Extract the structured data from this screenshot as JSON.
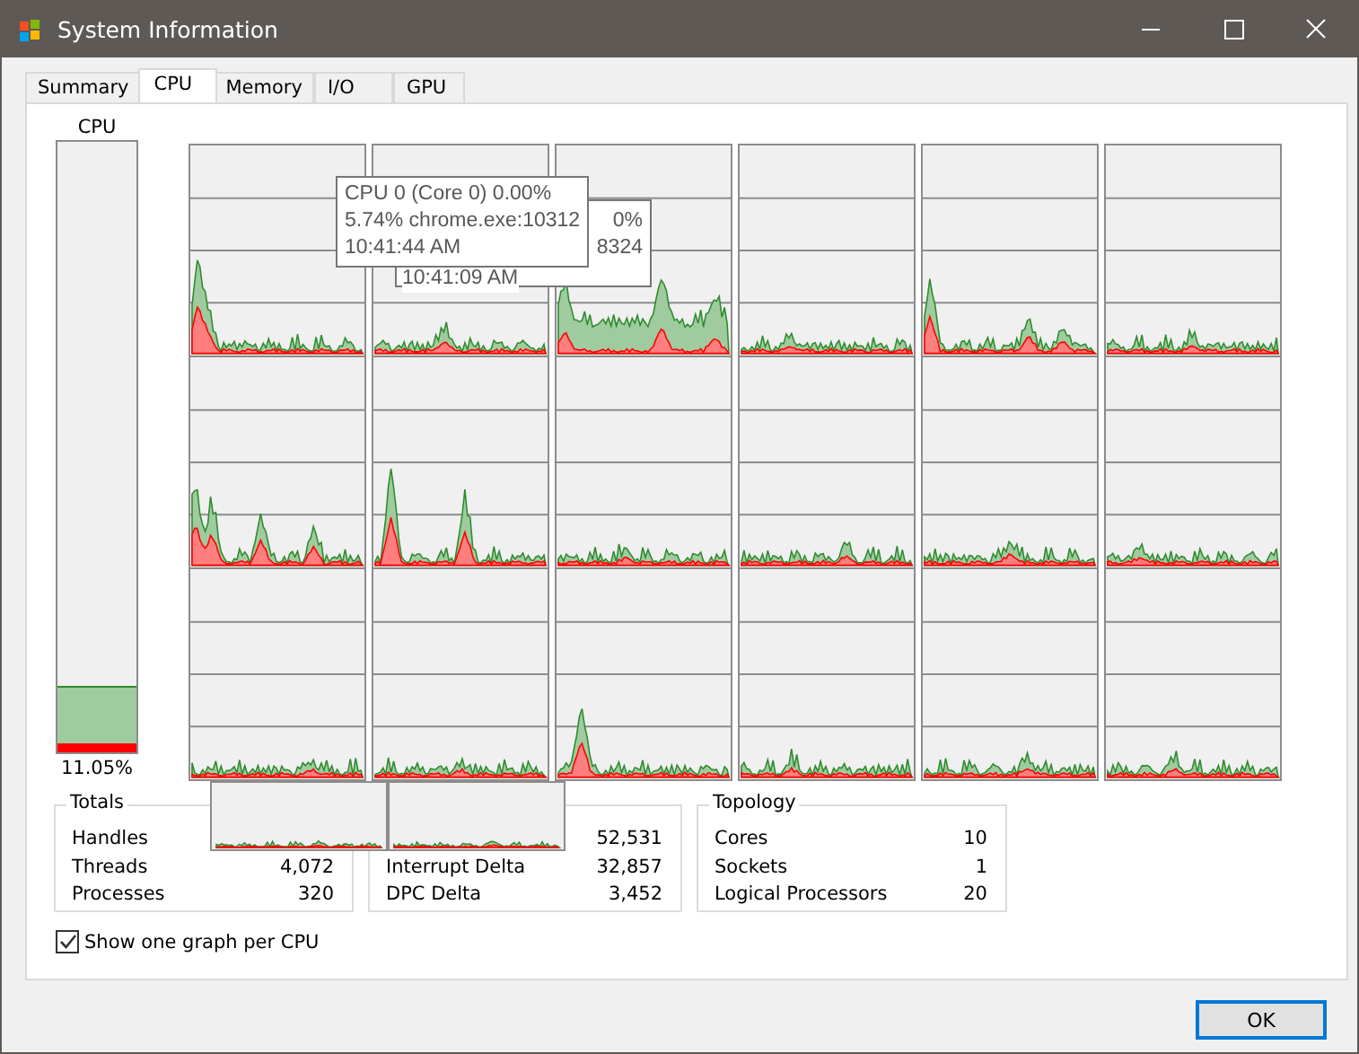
{
  "window": {
    "title": "System Information"
  },
  "tabs": [
    {
      "label": "Summary",
      "selected": false
    },
    {
      "label": "CPU",
      "selected": true
    },
    {
      "label": "Memory",
      "selected": false
    },
    {
      "label": "I/O",
      "selected": false
    },
    {
      "label": "GPU",
      "selected": false
    }
  ],
  "cpu_meter": {
    "label": "CPU",
    "level": 0.11,
    "kernel": {
      "level": 0.015
    },
    "reading": "11.05%"
  },
  "cpu_graphs": [
    {
      "kind": "graph"
    },
    {
      "kind": "graph"
    },
    {
      "kind": "graph"
    },
    {
      "kind": "graph"
    },
    {
      "kind": "graph"
    },
    {
      "kind": "graph"
    },
    {
      "kind": "graph"
    },
    {
      "kind": "graph"
    },
    {
      "kind": "graph"
    },
    {
      "kind": "graph"
    },
    {
      "kind": "graph"
    },
    {
      "kind": "graph"
    },
    {
      "kind": "graph"
    },
    {
      "kind": "graph"
    },
    {
      "kind": "graph"
    },
    {
      "kind": "graph"
    },
    {
      "kind": "graph"
    },
    {
      "kind": "graph"
    },
    {
      "kind": "stray"
    },
    {
      "kind": "stray"
    }
  ],
  "tooltips": [
    {
      "lines": [
        "0%",
        "8324",
        "10:41:09 AM"
      ]
    },
    {
      "lines": [
        "CPU 0 (Core 0) 0.00%",
        "5.74% chrome.exe:10312",
        "10:41:44 AM"
      ]
    }
  ],
  "groups": [
    {
      "title": "Totals",
      "rows": [
        {
          "label": "Handles"
        },
        {
          "label": "Threads",
          "value": "4,072"
        },
        {
          "label": "Processes",
          "value": "320"
        }
      ]
    },
    {
      "rows": [
        {
          "value": "52,531"
        },
        {
          "label": "Interrupt Delta",
          "value": "32,857"
        },
        {
          "label": "DPC Delta",
          "value": "3,452"
        }
      ]
    },
    {
      "title": "Topology",
      "rows": [
        {
          "label": "Cores",
          "value": "10"
        },
        {
          "label": "Sockets",
          "value": "1"
        },
        {
          "label": "Logical Processors",
          "value": "20"
        }
      ]
    }
  ],
  "show_per_cpu": {
    "label": "Show one graph per CPU",
    "checked": true
  },
  "buttons": [
    {
      "label": "OK"
    }
  ]
}
